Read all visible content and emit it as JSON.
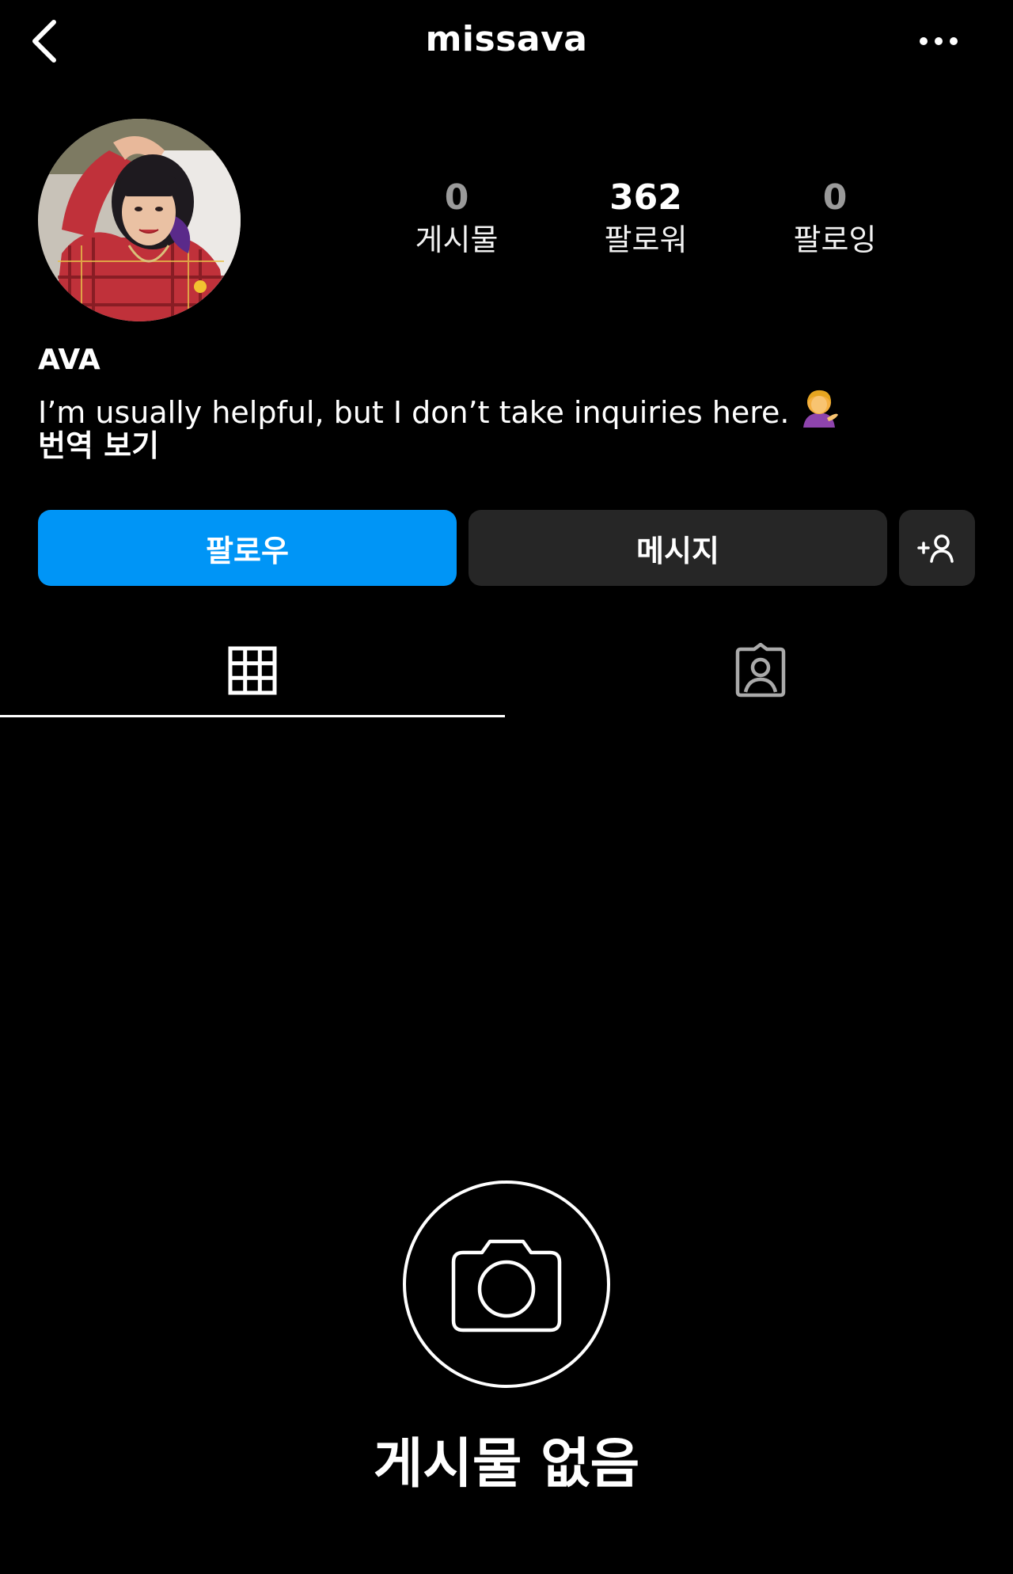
{
  "header": {
    "username": "missava",
    "back_icon": "chevron-left-icon",
    "more_icon": "more-horizontal-icon"
  },
  "profile": {
    "stats": [
      {
        "value": "0",
        "label": "게시물"
      },
      {
        "value": "362",
        "label": "팔로워"
      },
      {
        "value": "0",
        "label": "팔로잉"
      }
    ],
    "name": "AVA",
    "bio": "I’m usually helpful, but I don’t take inquiries here.",
    "bio_emoji": "person-tipping-hand-emoji",
    "translate_link": "번역 보기"
  },
  "actions": {
    "follow_label": "팔로우",
    "message_label": "메시지",
    "suggest_icon": "add-person-icon"
  },
  "tabs": [
    {
      "icon": "grid-icon",
      "active": true
    },
    {
      "icon": "tagged-person-icon",
      "active": false
    }
  ],
  "empty_state": {
    "icon": "camera-icon",
    "text": "게시물 없음"
  },
  "colors": {
    "background": "#000000",
    "accent": "#0095f6",
    "secondary_button": "#262626"
  }
}
